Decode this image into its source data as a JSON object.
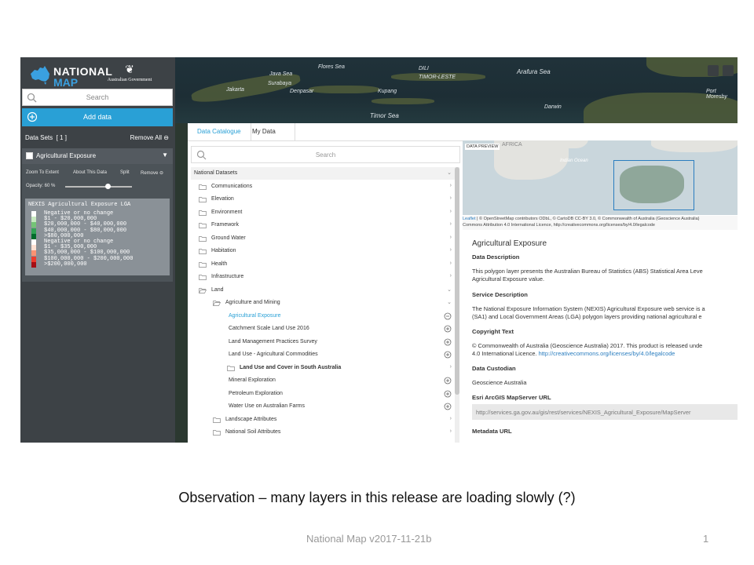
{
  "left_panel": {
    "logo_line1": "NATIONAL",
    "logo_line2": "MAP",
    "gov_text": "Australian Government",
    "search_placeholder": "Search",
    "add_data_label": "Add data",
    "data_sets_label": "Data Sets",
    "data_sets_count": "[ 1 ]",
    "remove_all_label": "Remove All",
    "layer": {
      "title": "Agricultural Exposure",
      "actions": [
        "Zoom To Extent",
        "About This Data",
        "Split",
        "Remove"
      ],
      "opacity_label": "Opacity: 60 %",
      "opacity_value": 0.6,
      "legend_title": "NEXIS Agricultural Exposure LGA",
      "legend_items": [
        {
          "label": "Negative or no change",
          "color": "#ffffff"
        },
        {
          "label": "$1 - $20,000,000",
          "color": "#c7e9c0"
        },
        {
          "label": "$20,000,000 - $40,000,000",
          "color": "#74c476"
        },
        {
          "label": "$40,000,000 - $80,000,000",
          "color": "#31a354"
        },
        {
          "label": ">$80,000,000",
          "color": "#006d2c"
        },
        {
          "label": "Negative or no change",
          "color": "#ffffff"
        },
        {
          "label": "$1 - $35,000,000",
          "color": "#fee0d2"
        },
        {
          "label": "$35,000,000 - $100,000,000",
          "color": "#fc9272"
        },
        {
          "label": "$100,000,000 - $200,000,000",
          "color": "#ef3b2c"
        },
        {
          "label": ">$200,000,000",
          "color": "#a50f15"
        }
      ]
    }
  },
  "map_labels": [
    "Flores Sea",
    "Java Sea",
    "Surabaya",
    "Denpasar",
    "Jakarta",
    "Kupang",
    "DILI",
    "TIMOR-LESTE",
    "Arafura Sea",
    "Timor Sea",
    "Darwin",
    "Port Moresby"
  ],
  "catalogue": {
    "tabs": [
      "Data Catalogue",
      "My Data"
    ],
    "search_placeholder": "Search",
    "items": [
      {
        "label": "National Datasets",
        "kind": "head"
      },
      {
        "label": "Communications",
        "kind": "folder"
      },
      {
        "label": "Elevation",
        "kind": "folder"
      },
      {
        "label": "Environment",
        "kind": "folder"
      },
      {
        "label": "Framework",
        "kind": "folder"
      },
      {
        "label": "Ground Water",
        "kind": "folder"
      },
      {
        "label": "Habitation",
        "kind": "folder"
      },
      {
        "label": "Health",
        "kind": "folder"
      },
      {
        "label": "Infrastructure",
        "kind": "folder"
      },
      {
        "label": "Land",
        "kind": "folder-open"
      },
      {
        "label": "Agriculture and Mining",
        "kind": "subfolder-open"
      },
      {
        "label": "Agricultural Exposure",
        "kind": "item-active"
      },
      {
        "label": "Catchment Scale Land Use 2016",
        "kind": "item"
      },
      {
        "label": "Land Management Practices Survey",
        "kind": "item"
      },
      {
        "label": "Land Use - Agricultural Commodities",
        "kind": "item"
      },
      {
        "label": "Land Use and Cover in South Australia",
        "kind": "subsubfolder"
      },
      {
        "label": "Mineral Exploration",
        "kind": "item"
      },
      {
        "label": "Petroleum Exploration",
        "kind": "item"
      },
      {
        "label": "Water Use on Australian Farms",
        "kind": "item"
      },
      {
        "label": "Landscape Attributes",
        "kind": "subfolder"
      },
      {
        "label": "National Soil Attributes",
        "kind": "subfolder"
      }
    ]
  },
  "preview": {
    "label": "DATA PREVIEW",
    "map_labels": [
      "AFRICA",
      "Indian Ocean"
    ],
    "attribution_link": "Leaflet",
    "attribution_line1": "| © OpenStreetMap contributors ODbL, © CartoDB CC-BY 3.0, © Commonwealth of Australia (Geoscience Australia)",
    "attribution_line2": "Commons Attribution 4.0 International Licence, http://creativecommons.org/licenses/by/4.0/legalcode",
    "title": "Agricultural Exposure",
    "data_description_label": "Data Description",
    "data_description_text1": "This polygon layer presents the Australian Bureau of Statistics (ABS) Statistical Area Leve",
    "data_description_text2": "Agricultural Exposure value.",
    "service_description_label": "Service Description",
    "service_description_text1": "The National Exposure Information System (NEXIS) Agricultural Exposure web service is a",
    "service_description_text2": "(SA1) and Local Government Areas (LGA) polygon layers providing national agricultural e",
    "copyright_label": "Copyright Text",
    "copyright_text1": "© Commonwealth of Australia (Geoscience Australia) 2017. This product is released unde",
    "copyright_text2_prefix": "4.0 International Licence. ",
    "copyright_link": "http://creativecommons.org/licenses/by/4.0/legalcode",
    "custodian_label": "Data Custodian",
    "custodian_text": "Geoscience Australia",
    "esri_label": "Esri ArcGIS MapServer URL",
    "esri_url": "http://services.ga.gov.au/gis/rest/services/NEXIS_Agricultural_Exposure/MapServer",
    "metadata_label": "Metadata URL"
  },
  "slide": {
    "caption": "Observation – many layers in this release are loading slowly (?)",
    "footer": "National Map v2017-11-21b",
    "page_number": "1"
  }
}
